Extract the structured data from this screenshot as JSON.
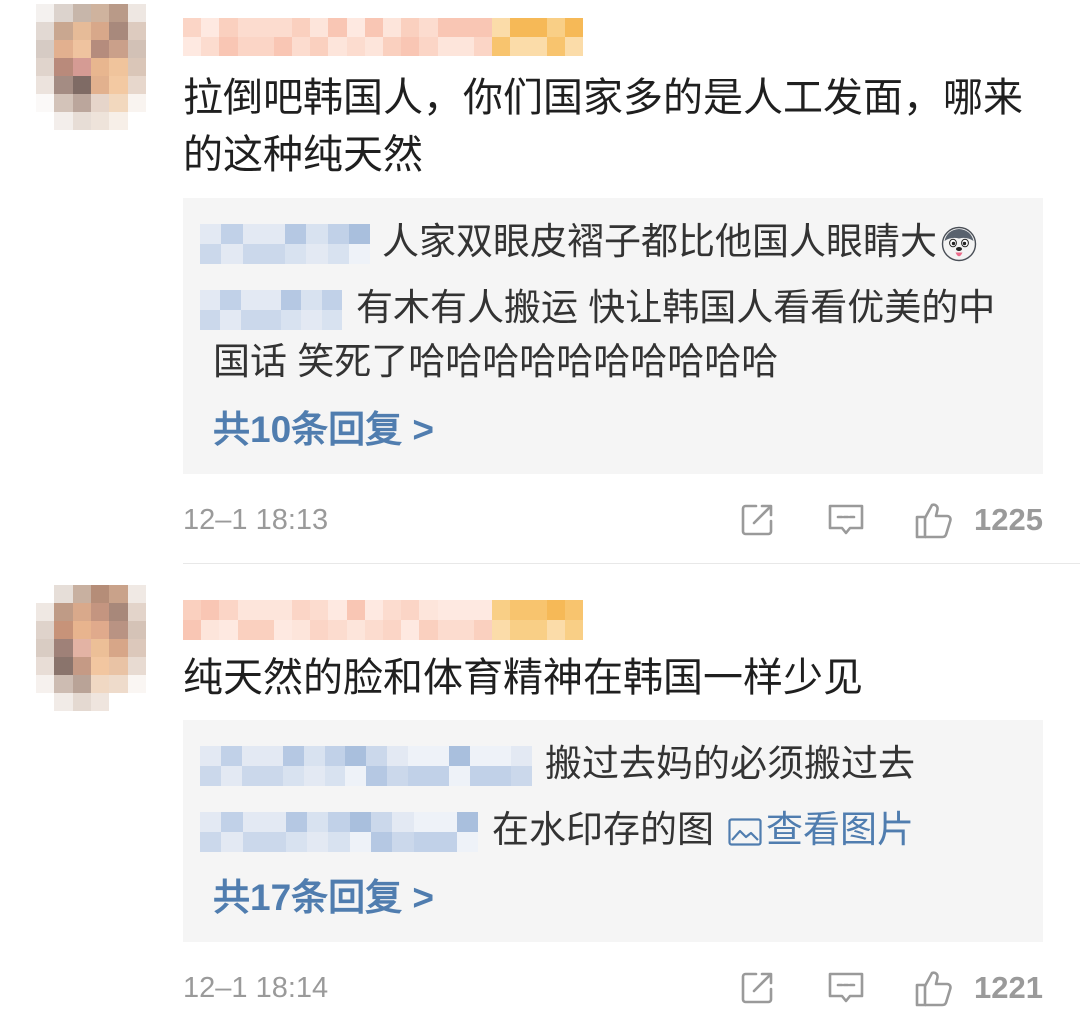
{
  "comments": [
    {
      "text": "拉倒吧韩国人，你们国家多的是人工发面，哪来的这种纯天然",
      "replies": [
        {
          "text": "人家双眼皮褶子都比他国人眼睛大",
          "emoji": "husky-emoji-icon"
        },
        {
          "text": "有木有人搬运 快让韩国人看看优美的中国话 笑死了哈哈哈哈哈哈哈哈哈哈"
        }
      ],
      "more_replies": "共10条回复 >",
      "time": "12–1 18:13",
      "likes": "1225"
    },
    {
      "text": "纯天然的脸和体育精神在韩国一样少见",
      "replies": [
        {
          "text": "搬过去妈的必须搬过去"
        },
        {
          "text": "在水印存的图",
          "icon": "image-icon",
          "link": "查看图片"
        }
      ],
      "more_replies": "共17条回复 >",
      "time": "12–1 18:14",
      "likes": "1221"
    }
  ],
  "footer_icons": [
    "share-icon",
    "comment-icon",
    "like-icon"
  ],
  "colors": {
    "main_text": "#1f1f1f",
    "reply_text": "#333333",
    "link": "#507daf",
    "meta": "#9a9a9a",
    "reply_background": "#f5f5f5",
    "divider": "#e8e8e8"
  },
  "palettes": {
    "avatar_1": [
      [
        "#f4f1ef",
        "#dcd3cd",
        "#c7b6aa",
        "#cfb39e",
        "#b99a88",
        "#eee7e2"
      ],
      [
        "#e2d9d3",
        "#c9a790",
        "#e6bb98",
        "#d8a88a",
        "#a8897c",
        "#ddcbbf"
      ],
      [
        "#d6cbc4",
        "#e2b08f",
        "#efc39f",
        "#b58c7d",
        "#caa08a",
        "#d2c1b6"
      ],
      [
        "#e0d4cc",
        "#b98a7b",
        "#d59b94",
        "#e8b68f",
        "#f0c49c",
        "#dac6b8"
      ],
      [
        "#ece3dd",
        "#a48c83",
        "#7f6b65",
        "#e2b18e",
        "#f3c9a2",
        "#e7d7cc"
      ],
      [
        "#fbf9f8",
        "#d3c3b9",
        "#bba69c",
        "#e6d5ca",
        "#f2d8be",
        "#f9f4f0"
      ],
      [
        "#ffffff",
        "#f3eeeb",
        "#e7ddd6",
        "#eee3da",
        "#f7efe8",
        "#ffffff"
      ]
    ],
    "avatar_2": [
      [
        "#ffffff",
        "#e6ded8",
        "#c8b0a0",
        "#b58d78",
        "#c9a28a",
        "#f0e9e4"
      ],
      [
        "#efe8e3",
        "#bf9b86",
        "#d9a98b",
        "#c49580",
        "#a8887a",
        "#e3d4ca"
      ],
      [
        "#dfd3cb",
        "#c79379",
        "#e8b48e",
        "#e0aa8c",
        "#b99383",
        "#d5c3b7"
      ],
      [
        "#d9ccc3",
        "#9f8178",
        "#e3b3a4",
        "#ecbf97",
        "#d7a688",
        "#dcc8bb"
      ],
      [
        "#e8ddd6",
        "#8a746c",
        "#c59a85",
        "#f2c6a0",
        "#e9c3a5",
        "#e8dbd2"
      ],
      [
        "#f6f1ee",
        "#cdbcb2",
        "#b9a397",
        "#f0d8c3",
        "#eedbcb",
        "#faf6f3"
      ],
      [
        "#ffffff",
        "#f1ebe7",
        "#e4d9d1",
        "#efe5de",
        "#ffffff",
        "#ffffff"
      ]
    ],
    "name_peach": [
      "#fde5db",
      "#fbd5c6",
      "#f9c6b4",
      "#fcdccf",
      "#fad0bf",
      "#fee9e1"
    ],
    "name_gold": [
      "#f9cf86",
      "#f6b957",
      "#f8c46e",
      "#fbdca9"
    ],
    "reply_blue": [
      "#e3e9f3",
      "#cbd8eb",
      "#b5c8e3",
      "#d8e2f0",
      "#a9bfdd",
      "#eef2f8",
      "#c1d1e8"
    ]
  }
}
